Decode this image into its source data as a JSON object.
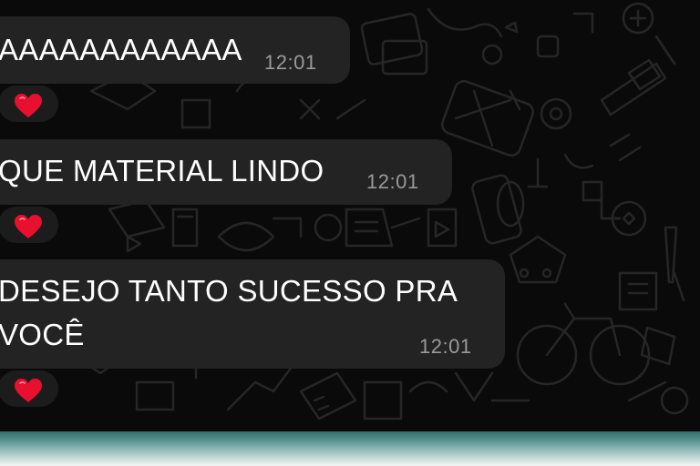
{
  "messages": [
    {
      "text_line1": "AAAAAAAAAAAA",
      "text_line2": "",
      "time": "12:01",
      "reaction": "❤"
    },
    {
      "text_line1": "QUE MATERIAL LINDO",
      "text_line2": "",
      "time": "12:01",
      "reaction": "❤"
    },
    {
      "text_line1": "DESEJO TANTO SUCESSO PRA",
      "text_line2": "VOCÊ",
      "time": "12:01",
      "reaction": "❤"
    }
  ],
  "colors": {
    "chat_background": "#0a0a0a",
    "bubble_incoming": "#232323",
    "timestamp": "#9a9a9a",
    "reaction_heart": "#e8102e",
    "bottom_bar": "#3f807c"
  },
  "icons": {
    "reaction": "heart-icon",
    "wallpaper": "doodle-pattern"
  }
}
